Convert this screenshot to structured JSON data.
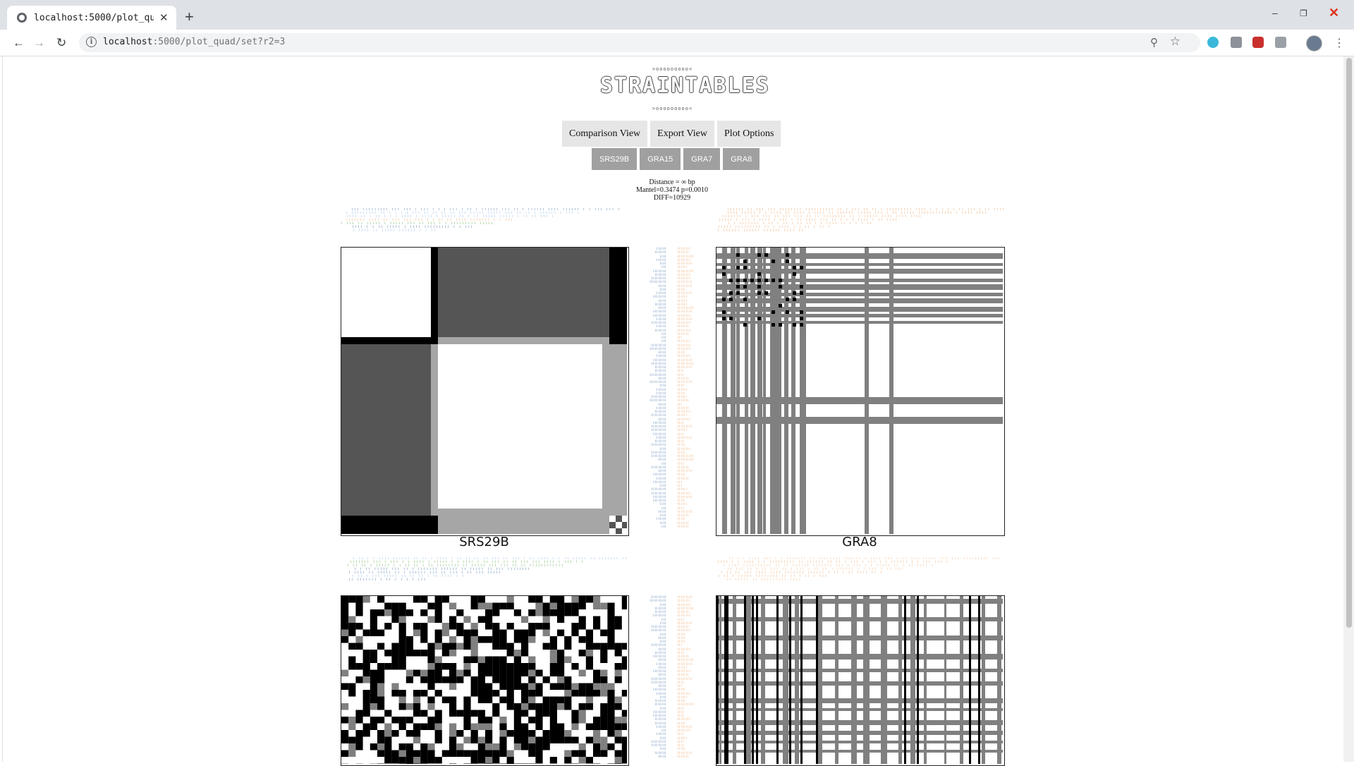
{
  "browser": {
    "tab_title": "localhost:5000/plot_qu",
    "tab_close": "✕",
    "new_tab": "+",
    "url_host": "localhost",
    "url_rest": ":5000/plot_quad/set?r2=3",
    "window_controls": {
      "minimize": "–",
      "maximize": "❐",
      "close": "✕"
    }
  },
  "page": {
    "logo": "STRAINTABLES",
    "logo_deco": ">ooooooooo<",
    "nav": [
      "Comparison View",
      "Export View",
      "Plot Options"
    ],
    "genes": [
      "SRS29B",
      "GRA15",
      "GRA7",
      "GRA8"
    ],
    "stats": {
      "distance": "Distance = ∞ bp",
      "mantel": "Mantel=0.3474 p=0.0010",
      "diff": "DIFF=10929"
    },
    "plots": [
      {
        "label": "SRS29B"
      },
      {
        "label": "GRA8"
      }
    ]
  },
  "colors": {
    "tree_blue": "#8ab4e0",
    "tree_dark_blue": "#3d6fa8",
    "tree_orange": "#f0a060",
    "tree_green": "#5aaa46",
    "heat_black": "#000000",
    "heat_dark": "#555555",
    "heat_mid": "#808080",
    "heat_light": "#a6a6a6"
  }
}
